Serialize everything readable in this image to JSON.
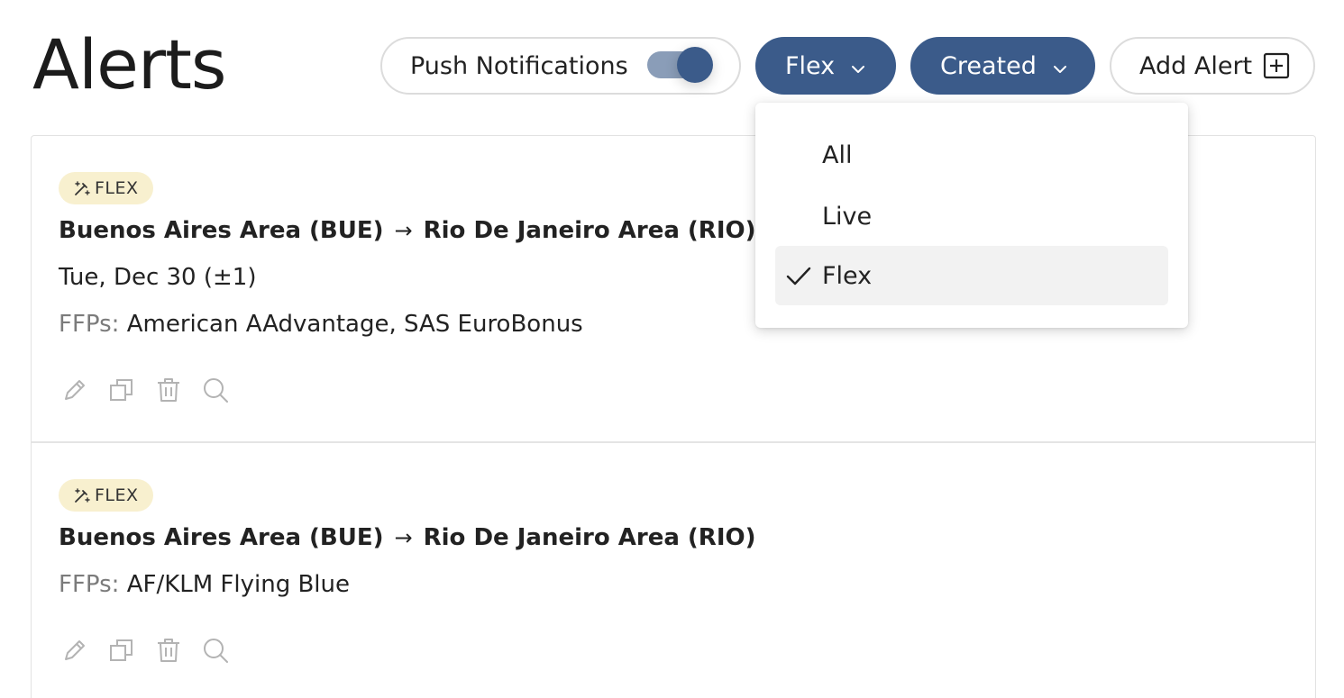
{
  "page": {
    "title": "Alerts"
  },
  "toolbar": {
    "push_label": "Push Notifications",
    "push_enabled": true,
    "filter_label": "Flex",
    "sort_label": "Created",
    "add_label": "Add Alert"
  },
  "filter_menu": {
    "items": [
      {
        "label": "All",
        "selected": false
      },
      {
        "label": "Live",
        "selected": false
      },
      {
        "label": "Flex",
        "selected": true
      }
    ]
  },
  "alerts": [
    {
      "badge": "FLEX",
      "origin": "Buenos Aires Area (BUE)",
      "destination": "Rio De Janeiro Area (RIO)",
      "date": "Tue, Dec 30 (±1)",
      "ffp_label": "FFPs:",
      "ffp_value": "American AAdvantage, SAS EuroBonus"
    },
    {
      "badge": "FLEX",
      "origin": "Buenos Aires Area (BUE)",
      "destination": "Rio De Janeiro Area (RIO)",
      "ffp_label": "FFPs:",
      "ffp_value": "AF/KLM Flying Blue"
    }
  ],
  "colors": {
    "primary": "#3b5b8a",
    "toggle_track": "#8a9db8",
    "badge_bg": "#f8f0cf",
    "muted_text": "#7b7b7b",
    "icon_gray": "#b3b3b3"
  }
}
